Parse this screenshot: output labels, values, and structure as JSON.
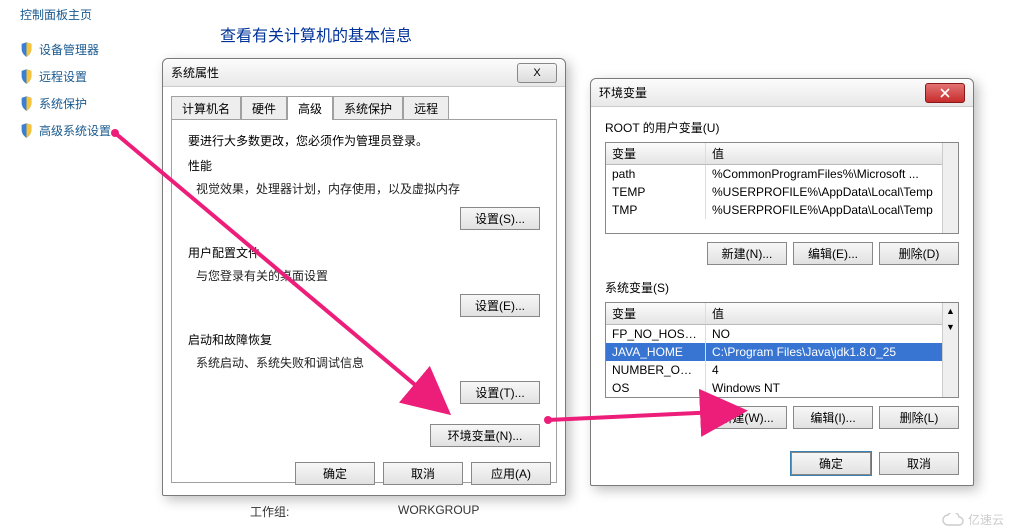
{
  "sidebar": {
    "home": "控制面板主页",
    "items": [
      "设备管理器",
      "远程设置",
      "系统保护",
      "高级系统设置"
    ]
  },
  "page": {
    "title": "查看有关计算机的基本信息"
  },
  "workgroup": {
    "label": "工作组:",
    "value": "WORKGROUP"
  },
  "sysprop": {
    "title": "系统属性",
    "close": "X",
    "tabs": [
      "计算机名",
      "硬件",
      "高级",
      "系统保护",
      "远程"
    ],
    "intro": "要进行大多数更改，您必须作为管理员登录。",
    "perf": {
      "title": "性能",
      "desc": "视觉效果，处理器计划，内存使用，以及虚拟内存",
      "btn": "设置(S)..."
    },
    "profile": {
      "title": "用户配置文件",
      "desc": "与您登录有关的桌面设置",
      "btn": "设置(E)..."
    },
    "startup": {
      "title": "启动和故障恢复",
      "desc": "系统启动、系统失败和调试信息",
      "btn": "设置(T)..."
    },
    "env_btn": "环境变量(N)...",
    "ok": "确定",
    "cancel": "取消",
    "apply": "应用(A)"
  },
  "env": {
    "title": "环境变量",
    "user_label": "ROOT 的用户变量(U)",
    "headers": {
      "var": "变量",
      "val": "值"
    },
    "user_rows": [
      {
        "k": "path",
        "v": "%CommonProgramFiles%\\Microsoft ..."
      },
      {
        "k": "TEMP",
        "v": "%USERPROFILE%\\AppData\\Local\\Temp"
      },
      {
        "k": "TMP",
        "v": "%USERPROFILE%\\AppData\\Local\\Temp"
      }
    ],
    "btns_user": {
      "new": "新建(N)...",
      "edit": "编辑(E)...",
      "del": "删除(D)"
    },
    "sys_label": "系统变量(S)",
    "sys_rows": [
      {
        "k": "FP_NO_HOST_C...",
        "v": "NO",
        "sel": false
      },
      {
        "k": "JAVA_HOME",
        "v": "C:\\Program Files\\Java\\jdk1.8.0_25",
        "sel": true
      },
      {
        "k": "NUMBER_OF_PR...",
        "v": "4",
        "sel": false
      },
      {
        "k": "OS",
        "v": "Windows NT",
        "sel": false
      }
    ],
    "btns_sys": {
      "new": "新建(W)...",
      "edit": "编辑(I)...",
      "del": "删除(L)"
    },
    "ok": "确定",
    "cancel": "取消"
  },
  "watermark": "亿速云"
}
